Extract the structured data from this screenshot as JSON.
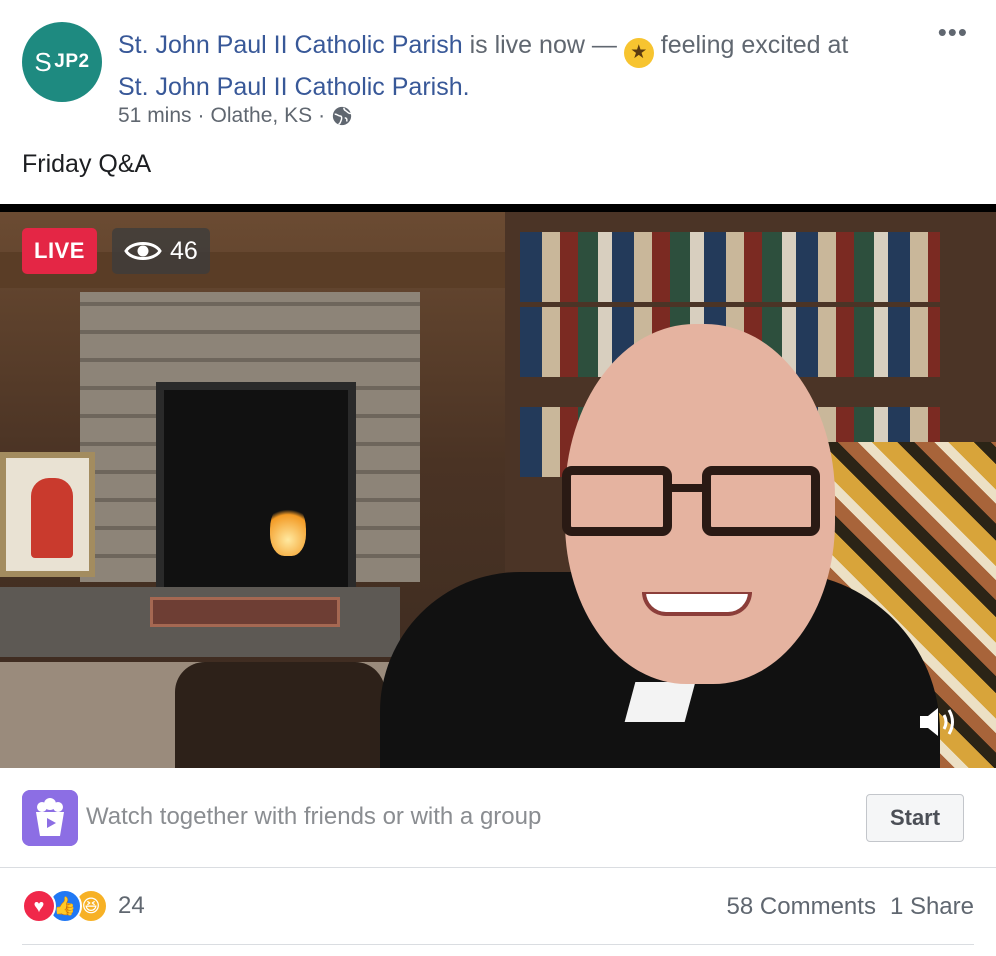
{
  "post": {
    "page_name": "St. John Paul II Catholic Parish",
    "status_text": "is live now —",
    "feeling_text": "feeling",
    "feeling_value": "excited at",
    "location_link": "St. John Paul II Catholic Parish.",
    "time": "51 mins",
    "location": "Olathe, KS",
    "separator": "·",
    "privacy_icon": "globe-icon",
    "avatar_text": "JP2",
    "avatar_cross": "S",
    "more_label": "•••",
    "text": "Friday Q&A",
    "emoji_icon": "grinning-star-eyes-icon"
  },
  "video": {
    "live_label": "LIVE",
    "viewer_count": "46",
    "viewer_icon": "eye-icon",
    "volume_icon": "volume-icon"
  },
  "watch_party": {
    "icon": "watch-party-icon",
    "text": "Watch together with friends or with a group",
    "start_label": "Start"
  },
  "stats": {
    "reaction_count": "24",
    "reactions": [
      "love",
      "like",
      "haha"
    ],
    "comments": "58 Comments",
    "shares": "1 Share"
  },
  "colors": {
    "link": "#385898",
    "live": "#e42645",
    "avatar": "#1e8a80",
    "watch_icon": "#8c6ee4"
  }
}
